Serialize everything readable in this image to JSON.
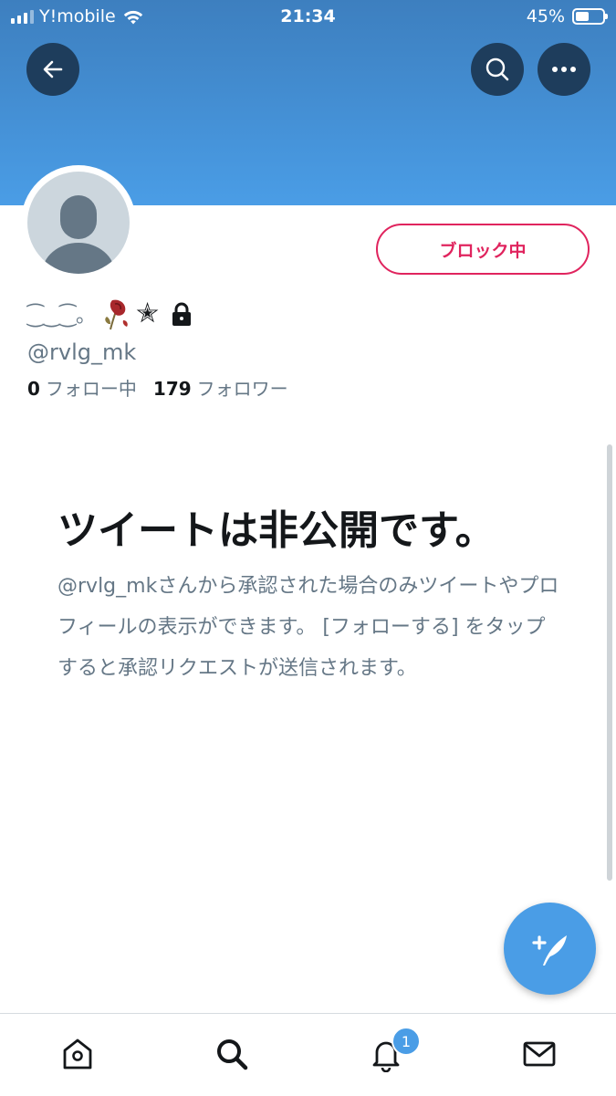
{
  "status_bar": {
    "carrier": "Y!mobile",
    "time": "21:34",
    "battery": "45%"
  },
  "header": {
    "back_icon": "arrow-left-icon",
    "search_icon": "search-icon",
    "more_icon": "more-horizontal-icon"
  },
  "profile": {
    "display_name_decoration": "⁐‿⁐。",
    "display_name_star": "✭",
    "handle": "@rvlg_mk",
    "following_count": "0",
    "following_label": "フォロー中",
    "followers_count": "179",
    "followers_label": "フォロワー",
    "block_button_label": "ブロック中",
    "protected_icon": "lock-icon"
  },
  "private_notice": {
    "title": "ツイートは非公開です。",
    "body": "@rvlg_mkさんから承認された場合のみツイートやプロフィールの表示ができます。 [フォローする] をタップすると承認リクエストが送信されます。"
  },
  "fab": {
    "icon": "compose-tweet-icon"
  },
  "tab_bar": {
    "items": [
      {
        "icon": "home-icon"
      },
      {
        "icon": "search-icon"
      },
      {
        "icon": "bell-icon",
        "badge": "1"
      },
      {
        "icon": "mail-icon"
      }
    ]
  },
  "colors": {
    "banner": "#4a9de6",
    "accent": "#4a9de6",
    "block_red": "#e0245e",
    "secondary_text": "#657786"
  }
}
